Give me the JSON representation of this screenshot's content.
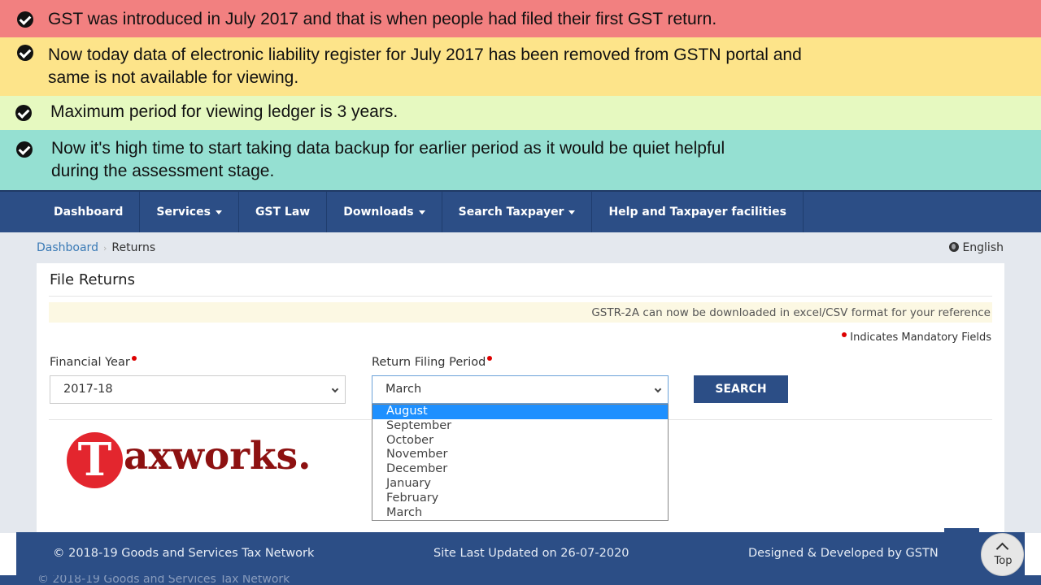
{
  "notes": [
    "GST was introduced in July 2017 and that is when people had filed their first GST return.",
    "Now today data of electronic liability register for July 2017 has been removed from GSTN portal and",
    "same is not available for viewing.",
    "Maximum period for viewing ledger is 3 years.",
    "Now it's high time to start taking data backup for earlier period as it would be quiet helpful",
    "during the assessment stage."
  ],
  "note_colors": [
    "#f28080",
    "#fde48a",
    "#e6f9c0",
    "#95e0d2"
  ],
  "nav": {
    "items": [
      "Dashboard",
      "Services",
      "GST Law",
      "Downloads",
      "Search Taxpayer",
      "Help and Taxpayer facilities"
    ]
  },
  "breadcrumb": {
    "home": "Dashboard",
    "current": "Returns"
  },
  "language": "English",
  "panel": {
    "title": "File Returns",
    "info": "GSTR-2A can now be downloaded in excel/CSV format for your reference",
    "mandatory": "Indicates Mandatory Fields",
    "fy_label": "Financial Year",
    "fy_value": "2017-18",
    "rfp_label": "Return Filing Period",
    "rfp_value": "March",
    "search": "SEARCH"
  },
  "dropdown_options": [
    "August",
    "September",
    "October",
    "November",
    "December",
    "January",
    "February",
    "March"
  ],
  "dropdown_highlighted": "August",
  "logo": {
    "letter": "T",
    "text": "axworks."
  },
  "footer": {
    "copyright": "© 2018-19 Goods and Services Tax Network",
    "updated": "Site Last Updated on 26-07-2020",
    "developer": "Designed & Developed by GSTN",
    "top": "Top"
  },
  "brand_color": "#2c4e86"
}
